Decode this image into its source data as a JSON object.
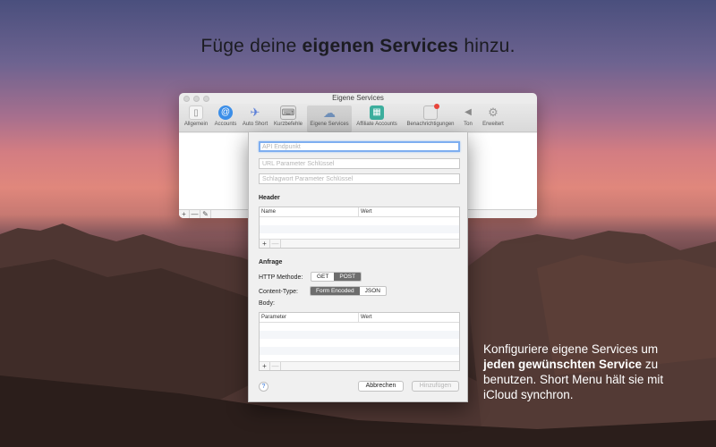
{
  "headline": {
    "pre": "Füge deine ",
    "bold": "eigenen Services",
    "post": " hinzu."
  },
  "caption": {
    "line1": "Konfiguriere eigene Services um",
    "bold": "jeden gewünschten Service",
    "line2_rest": " zu",
    "line3": "benutzen. Short Menu hält sie mit",
    "line4": "iCloud synchron."
  },
  "window": {
    "title": "Eigene Services",
    "toolbar": [
      {
        "label": "Allgemein",
        "icon": "toggle-icon",
        "color": "#f2f2f2",
        "glyph": "▯"
      },
      {
        "label": "Accounts",
        "icon": "at-icon",
        "color": "#3b8ee8",
        "glyph": "@"
      },
      {
        "label": "Auto Short",
        "icon": "rocket-icon",
        "color": "#5a7ed8",
        "glyph": "✈"
      },
      {
        "label": "Kurzbefehle",
        "icon": "keyboard-icon",
        "color": "#8b8b8b",
        "glyph": "⌨"
      },
      {
        "label": "Eigene Services",
        "icon": "cloud-icon",
        "color": "#6f8fb8",
        "glyph": "☁"
      },
      {
        "label": "Affiliate Accounts",
        "icon": "affiliate-icon",
        "color": "#3cae9d",
        "glyph": "▦"
      },
      {
        "label": "Benachrichtigungen",
        "icon": "notification-icon",
        "color": "#d8d8d8",
        "glyph": "▢"
      },
      {
        "label": "Ton",
        "icon": "speaker-icon",
        "color": "#9a9a9a",
        "glyph": "◀"
      },
      {
        "label": "Erweitert",
        "icon": "gear-icon",
        "color": "#a9a9a9",
        "glyph": "⚙"
      }
    ],
    "footer_buttons": [
      "+",
      "—",
      "✎"
    ]
  },
  "sheet": {
    "api_endpoint_placeholder": "API Endpunkt",
    "url_param_placeholder": "URL Parameter Schlüssel",
    "keyword_param_placeholder": "Schlagwort Parameter Schlüssel",
    "header_title": "Header",
    "header_table": {
      "col_name": "Name",
      "col_value": "Wert",
      "add": "+",
      "remove": "—"
    },
    "request_title": "Anfrage",
    "http_method_label": "HTTP Methode:",
    "http_methods": [
      "GET",
      "POST"
    ],
    "http_method_selected": "POST",
    "content_type_label": "Content-Type:",
    "content_types": [
      "Form Encoded",
      "JSON"
    ],
    "content_type_selected": "Form Encoded",
    "body_label": "Body:",
    "body_table": {
      "col_name": "Parameter",
      "col_value": "Wert",
      "add": "+",
      "remove": "—"
    },
    "help": "?",
    "cancel_label": "Abbrechen",
    "add_label": "Hinzufügen"
  }
}
